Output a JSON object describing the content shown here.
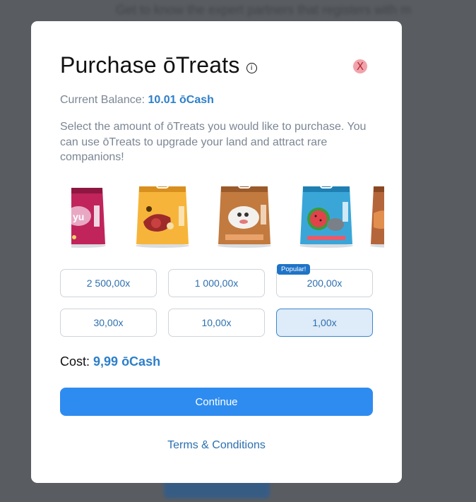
{
  "modal": {
    "title": "Purchase ōTreats",
    "info_icon": "info-icon",
    "close_label": "X",
    "balance_label": "Current Balance:",
    "balance_value": "10.01 ōCash",
    "description": "Select the amount of ōTreats you would like to purchase. You can use ōTreats to upgrade your land and attract rare companions!",
    "products": [
      {
        "icon": "pink-treat-bag"
      },
      {
        "icon": "orange-treat-bag"
      },
      {
        "icon": "brown-treat-bag"
      },
      {
        "icon": "blue-watermelon-treat-bag"
      },
      {
        "icon": "partial-treat-bag"
      }
    ],
    "options": [
      {
        "label": "2 500,00x",
        "selected": false
      },
      {
        "label": "1 000,00x",
        "selected": false
      },
      {
        "label": "200,00x",
        "selected": false,
        "badge": "Popular!"
      },
      {
        "label": "30,00x",
        "selected": false
      },
      {
        "label": "10,00x",
        "selected": false
      },
      {
        "label": "1,00x",
        "selected": true
      }
    ],
    "cost_label": "Cost:",
    "cost_value": "9,99 ōCash",
    "continue_label": "Continue",
    "terms_label": "Terms & Conditions"
  },
  "background": {
    "text": "Get to know the expert partners that registers with m"
  },
  "colors": {
    "accent": "#2e8cf0",
    "link": "#2c6faf",
    "muted_text": "#7b8694",
    "close_bg": "#f2a3aa",
    "selected_bg": "#deebf8"
  }
}
